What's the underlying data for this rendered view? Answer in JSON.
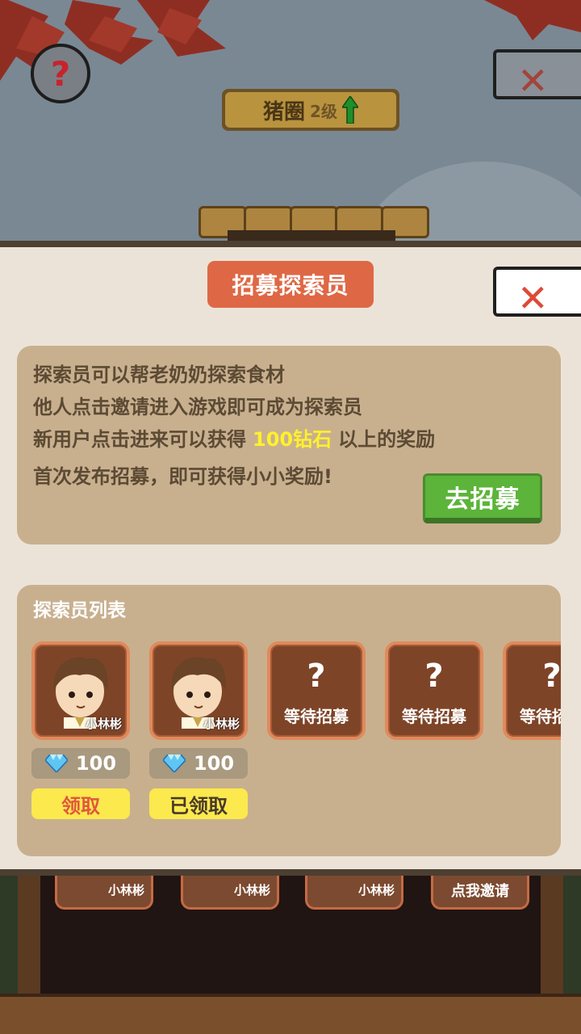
{
  "scene": {
    "help_symbol": "?",
    "close_symbol": "✕",
    "sign_title": "猪圈",
    "sign_level": "2级",
    "shelf_cards": [
      {
        "label": "小林彬"
      },
      {
        "label": "小林彬"
      },
      {
        "label": "小林彬"
      },
      {
        "label": "点我邀请"
      }
    ]
  },
  "panel": {
    "title": "招募探索员",
    "close_symbol": "✕",
    "info": {
      "line1": "探索员可以帮老奶奶探索食材",
      "line2": "他人点击邀请进入游戏即可成为探索员",
      "line3_pre": "新用户点击进来可以获得",
      "line3_highlight": "100钻石",
      "line3_post": "以上的奖励",
      "line4": "首次发布招募，即可获得小小奖励!",
      "button": "去招募"
    },
    "list": {
      "title": "探索员列表",
      "slots": [
        {
          "name": "小林彬",
          "reward": "100",
          "claim": "领取"
        },
        {
          "name": "小林彬",
          "reward": "100",
          "claim": "已领取"
        },
        {
          "q": "?",
          "wait": "等待招募"
        },
        {
          "q": "?",
          "wait": "等待招募"
        },
        {
          "q": "?",
          "wait": "等待招募"
        }
      ]
    }
  },
  "colors": {
    "title_bg": "#de6845",
    "highlight": "#fff12b",
    "button_green": "#5cb43a",
    "claim_yellow": "#fbe94d"
  },
  "icons": {
    "help": "question-icon",
    "close": "close-icon",
    "level_up": "up-arrow-icon",
    "diamond": "diamond-icon"
  }
}
